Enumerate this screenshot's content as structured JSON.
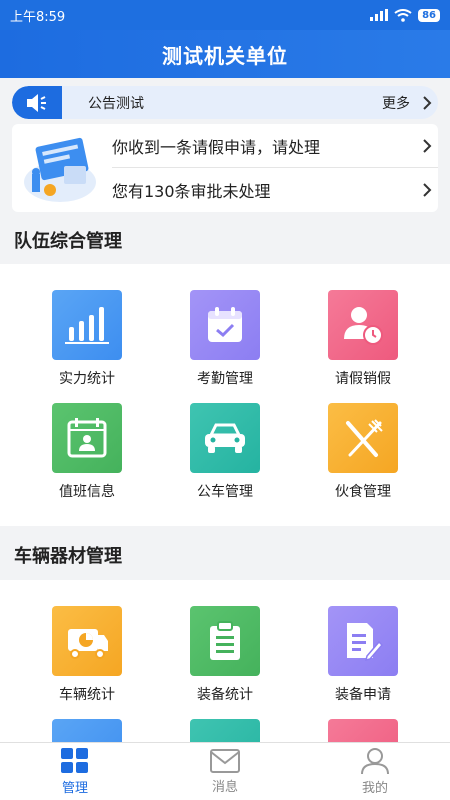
{
  "status": {
    "time": "上午8:59",
    "battery": "86"
  },
  "header": {
    "title": "测试机关单位"
  },
  "notice": {
    "text": "公告测试",
    "more": "更多"
  },
  "alerts": [
    {
      "text": "你收到一条请假申请，请处理"
    },
    {
      "text": "您有130条审批未处理"
    }
  ],
  "sections": [
    {
      "title": "队伍综合管理",
      "items": [
        {
          "label": "实力统计",
          "icon": "bar-chart-icon",
          "color": "#3d8ef0"
        },
        {
          "label": "考勤管理",
          "icon": "calendar-check-icon",
          "color": "#8c7ef2"
        },
        {
          "label": "请假销假",
          "icon": "user-clock-icon",
          "color": "#ee5a7e"
        },
        {
          "label": "值班信息",
          "icon": "duty-calendar-icon",
          "color": "#45b25c"
        },
        {
          "label": "公车管理",
          "icon": "car-icon",
          "color": "#25b3a1"
        },
        {
          "label": "伙食管理",
          "icon": "fork-knife-icon",
          "color": "#f5a623"
        }
      ]
    },
    {
      "title": "车辆器材管理",
      "items": [
        {
          "label": "车辆统计",
          "icon": "truck-chart-icon",
          "color": "#f5a623"
        },
        {
          "label": "装备统计",
          "icon": "clipboard-icon",
          "color": "#45b25c"
        },
        {
          "label": "装备申请",
          "icon": "document-edit-icon",
          "color": "#8c7ef2"
        }
      ]
    }
  ],
  "tabs": [
    {
      "label": "管理",
      "icon": "grid-icon",
      "active": true
    },
    {
      "label": "消息",
      "icon": "mail-icon",
      "active": false
    },
    {
      "label": "我的",
      "icon": "person-icon",
      "active": false
    }
  ]
}
